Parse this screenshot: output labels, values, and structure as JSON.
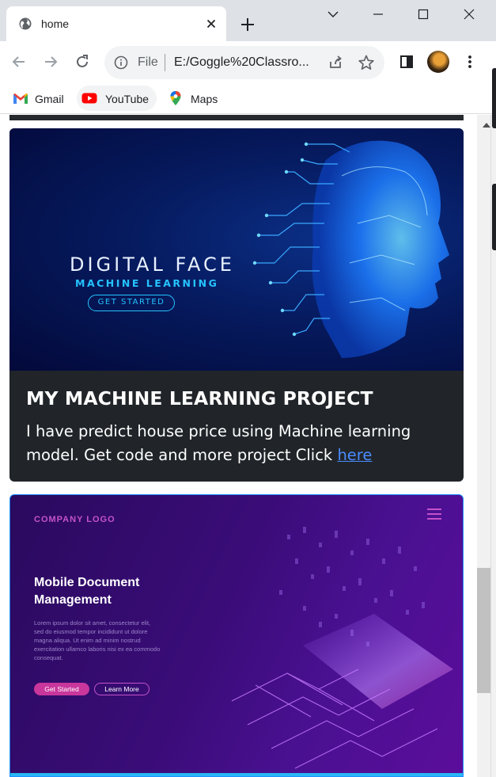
{
  "browser": {
    "tab": {
      "title": "home",
      "favicon": "globe-icon"
    },
    "window_controls": [
      "chevron-down-icon",
      "minimize-icon",
      "maximize-icon",
      "close-icon"
    ],
    "toolbar": {
      "scheme_label": "File",
      "url": "E:/Goggle%20Classro...",
      "icons": [
        "back-icon",
        "forward-icon",
        "reload-icon",
        "info-icon",
        "share-icon",
        "star-icon",
        "sidepanel-icon",
        "profile-avatar",
        "kebab-menu-icon"
      ]
    },
    "bookmarks": [
      {
        "label": "Gmail",
        "icon": "gmail-icon"
      },
      {
        "label": "YouTube",
        "icon": "youtube-icon"
      },
      {
        "label": "Maps",
        "icon": "maps-icon"
      }
    ]
  },
  "page": {
    "card1": {
      "image": {
        "title": "DIGITAL FACE",
        "subtitle": "MACHINE LEARNING",
        "button": "GET STARTED"
      },
      "title": "MY MACHINE LEARNING PROJECT",
      "text": "I have predict house price using Machine learning model. Get code and more project Click ",
      "link": "here"
    },
    "card2": {
      "logo": "COMPANY LOGO",
      "heading": "Mobile Document Management",
      "lorem": "Lorem ipsum dolor sit amet, consectetur elit, sed do eiusmod tempor incididunt ut dolore magna aliqua. Ut enim ad minim nostrud exercitation ullamco laboris nisi ex ea commodo consequat.",
      "primary_button": "Get Started",
      "secondary_button": "Learn More"
    }
  },
  "colors": {
    "tab_strip": "#dee1e6",
    "card_dark": "#212529",
    "link": "#4a8cff",
    "accent_cyan": "#25c3ff",
    "card2_border": "#1e90ff"
  }
}
